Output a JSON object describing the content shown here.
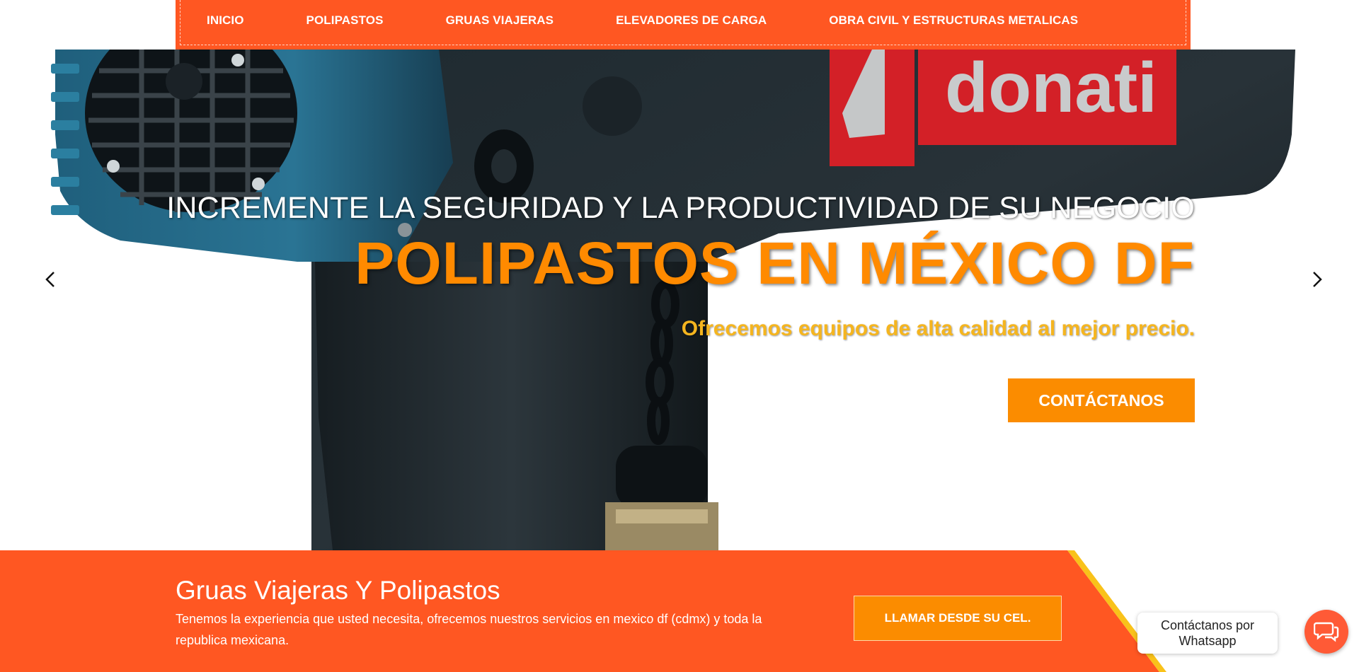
{
  "nav": {
    "items": [
      {
        "label": "INICIO"
      },
      {
        "label": "POLIPASTOS"
      },
      {
        "label": "GRUAS VIAJERAS"
      },
      {
        "label": "ELEVADORES DE CARGA"
      },
      {
        "label": "OBRA CIVIL Y ESTRUCTURAS METALICAS"
      }
    ]
  },
  "hero": {
    "kicker": "INCREMENTE LA SEGURIDAD Y LA PRODUCTIVIDAD DE SU NEGOCIO",
    "title": "POLIPASTOS EN MÉXICO DF",
    "subtitle": "Ofrecemos equipos de alta calidad al mejor precio.",
    "cta_label": "CONTÁCTANOS",
    "image_brand_text": "donati",
    "prev_icon": "chevron-left-icon",
    "next_icon": "chevron-right-icon"
  },
  "banner": {
    "title": "Gruas Viajeras Y Polipastos",
    "text": "Tenemos la experiencia que usted necesita, ofrecemos nuestros servicios en mexico df (cdmx) y toda la republica mexicana.",
    "button_label": "LLAMAR DESDE SU CEL."
  },
  "whatsapp": {
    "bubble_text": "Contáctanos por Whatsapp",
    "icon": "chat-icon"
  },
  "colors": {
    "primary_orange": "#ff5722",
    "button_orange": "#fb8c00",
    "title_orange": "#ff8a00",
    "subtitle_yellow": "#f5b51f",
    "accent_yellow": "#f9c21a"
  }
}
